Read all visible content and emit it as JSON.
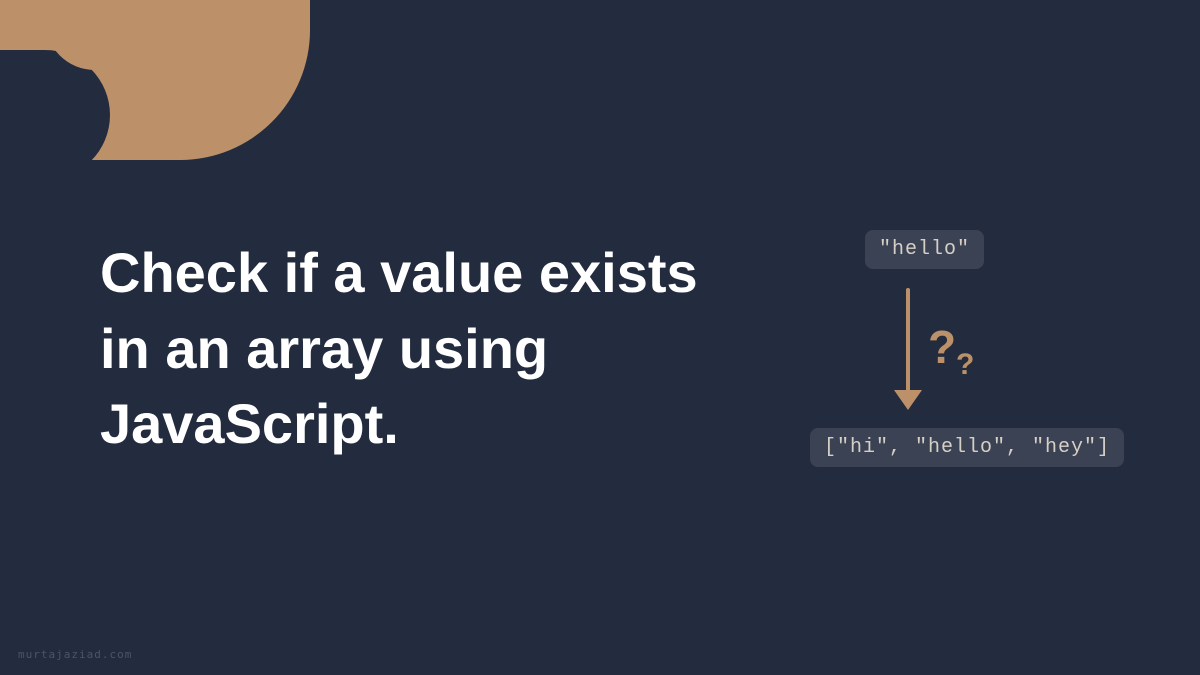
{
  "heading": "Check if a value exists in an array using JavaScript.",
  "value_code": "\"hello\"",
  "array_code": "[\"hi\", \"hello\", \"hey\"]",
  "question_large": "?",
  "question_small": "?",
  "watermark": "murtajaziad.com",
  "colors": {
    "background": "#232c3f",
    "accent": "#bc9169",
    "text": "#ffffff",
    "badge_bg": "#3a4254",
    "badge_text": "#d6cfc6"
  }
}
